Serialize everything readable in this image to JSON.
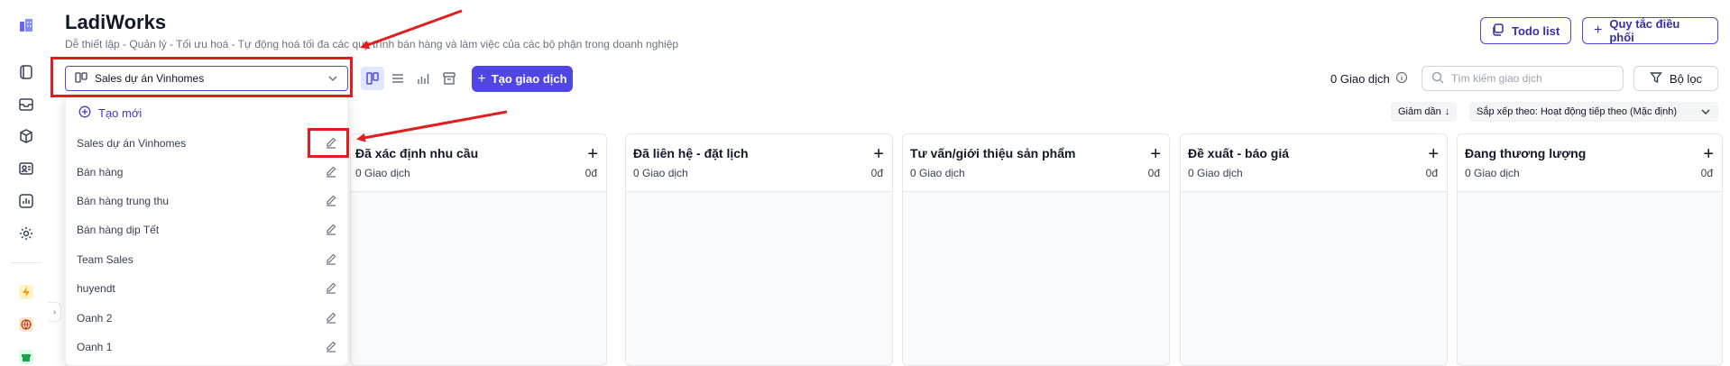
{
  "app": {
    "title": "LadiWorks",
    "subtitle": "Dễ thiết lập - Quản lý - Tối ưu hoá - Tự động hoá tối đa các quy trình bán hàng và làm việc của các bộ phận trong doanh nghiệp"
  },
  "header_buttons": {
    "todo_label": "Todo list",
    "rules_label": "Quy tắc điều phối"
  },
  "pipeline_select": {
    "value": "Sales dự án Vinhomes"
  },
  "toolbar": {
    "create_label": "Tạo giao dịch",
    "deal_count": "0 Giao dịch",
    "search_placeholder": "Tìm kiếm giao dịch",
    "filter_label": "Bộ lọc",
    "sort_direction": "Giảm dần",
    "sort_by": "Sắp xếp theo: Hoạt động tiếp theo (Mặc định)"
  },
  "dropdown": {
    "new_label": "Tạo mới",
    "items": [
      "Sales dự án Vinhomes",
      "Bán hàng",
      "Bán hàng trung thu",
      "Bán hàng dịp Tết",
      "Team Sales",
      "huyendt",
      "Oanh 2",
      "Oanh 1"
    ]
  },
  "columns": [
    {
      "name": "Đã xác định nhu cầu",
      "count": "0 Giao dịch",
      "amount": "0đ"
    },
    {
      "name": "Đã liên hệ - đặt lịch",
      "count": "0 Giao dịch",
      "amount": "0đ"
    },
    {
      "name": "Tư vấn/giới thiệu sản phẩm",
      "count": "0 Giao dịch",
      "amount": "0đ"
    },
    {
      "name": "Đề xuất - báo giá",
      "count": "0 Giao dịch",
      "amount": "0đ"
    },
    {
      "name": "Đang thương lượng",
      "count": "0 Giao dịch",
      "amount": "0đ"
    }
  ],
  "colors": {
    "accent": "#4f46e5",
    "annotation": "#e11d1d"
  },
  "icons": {
    "rail": [
      "building-icon",
      "inbox-icon",
      "layers-icon",
      "box-icon",
      "contact-card-icon",
      "chart-icon",
      "settings-icon",
      "lightning-icon",
      "globe-icon",
      "store-icon"
    ]
  }
}
